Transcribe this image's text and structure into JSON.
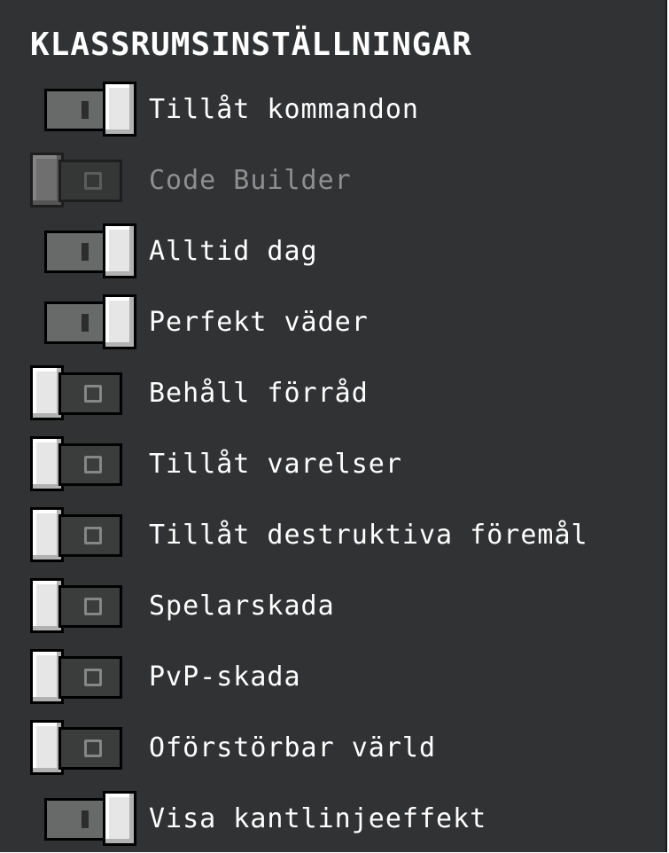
{
  "panel": {
    "title": "KLASSRUMSINSTÄLLNINGAR"
  },
  "settings": [
    {
      "label": "Tillåt kommandon",
      "state": "on",
      "enabled": true
    },
    {
      "label": "Code Builder",
      "state": "off",
      "enabled": false
    },
    {
      "label": "Alltid dag",
      "state": "on",
      "enabled": true
    },
    {
      "label": "Perfekt väder",
      "state": "on",
      "enabled": true
    },
    {
      "label": "Behåll förråd",
      "state": "off",
      "enabled": true
    },
    {
      "label": "Tillåt varelser",
      "state": "off",
      "enabled": true
    },
    {
      "label": "Tillåt destruktiva föremål",
      "state": "off",
      "enabled": true
    },
    {
      "label": "Spelarskada",
      "state": "off",
      "enabled": true
    },
    {
      "label": "PvP-skada",
      "state": "off",
      "enabled": true
    },
    {
      "label": "Oförstörbar värld",
      "state": "off",
      "enabled": true
    },
    {
      "label": "Visa kantlinjeeffekt",
      "state": "on",
      "enabled": true
    }
  ],
  "colors": {
    "panel_bg": "#313233",
    "text": "#ffffff",
    "text_disabled": "#8f8f8f",
    "toggle_on_track": "#686969",
    "toggle_off_track": "#3b3c3c",
    "knob": "#e6e6e6"
  }
}
